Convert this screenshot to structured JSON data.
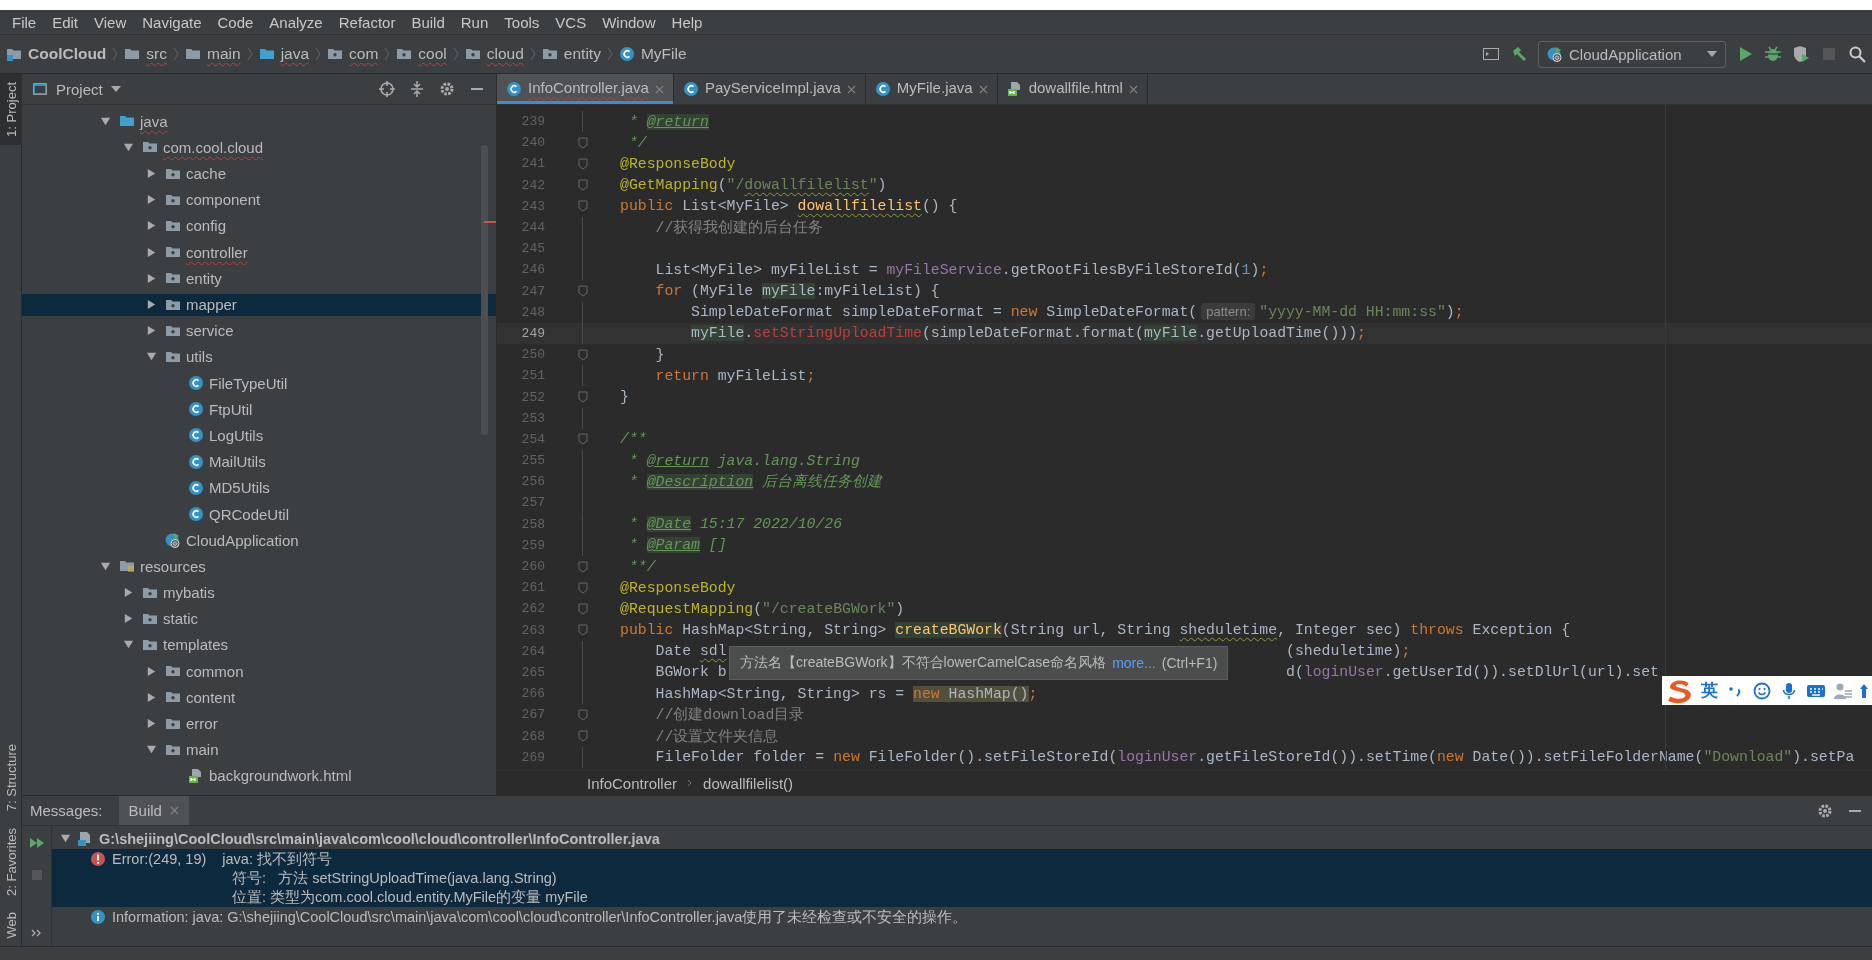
{
  "menu": [
    "File",
    "Edit",
    "View",
    "Navigate",
    "Code",
    "Analyze",
    "Refactor",
    "Build",
    "Run",
    "Tools",
    "VCS",
    "Window",
    "Help"
  ],
  "navigation_bar": [
    {
      "label": "CoolCloud",
      "kind": "project",
      "misspelled": false
    },
    {
      "label": "src",
      "kind": "folder",
      "misspelled": true
    },
    {
      "label": "main",
      "kind": "folder",
      "misspelled": true
    },
    {
      "label": "java",
      "kind": "source-folder",
      "misspelled": true
    },
    {
      "label": "com",
      "kind": "package",
      "misspelled": true
    },
    {
      "label": "cool",
      "kind": "package",
      "misspelled": true
    },
    {
      "label": "cloud",
      "kind": "package",
      "misspelled": true
    },
    {
      "label": "entity",
      "kind": "package",
      "misspelled": false
    },
    {
      "label": "MyFile",
      "kind": "class",
      "misspelled": false
    }
  ],
  "toolbar": {
    "run_configuration": "CloudApplication",
    "stop_enabled": false
  },
  "left_stripe": {
    "top": [
      {
        "label": "1: Project",
        "selected": true
      }
    ],
    "bottom": [
      {
        "label": "7: Structure",
        "selected": false
      },
      {
        "label": "2: Favorites",
        "selected": false
      },
      {
        "label": "Web",
        "selected": false
      }
    ]
  },
  "project_panel": {
    "title": "Project"
  },
  "tree": [
    {
      "label": "java",
      "kind": "source-folder",
      "expanded": true,
      "selected": false,
      "misspelled": true,
      "children": [
        {
          "label": "com.cool.cloud",
          "kind": "package",
          "expanded": true,
          "selected": false,
          "misspelled": true,
          "children": [
            {
              "label": "cache",
              "kind": "package",
              "expanded": false,
              "selected": false,
              "misspelled": false
            },
            {
              "label": "component",
              "kind": "package",
              "expanded": false,
              "selected": false,
              "misspelled": false
            },
            {
              "label": "config",
              "kind": "package",
              "expanded": false,
              "selected": false,
              "misspelled": false
            },
            {
              "label": "controller",
              "kind": "package",
              "expanded": false,
              "selected": false,
              "misspelled": true
            },
            {
              "label": "entity",
              "kind": "package",
              "expanded": false,
              "selected": false,
              "misspelled": false
            },
            {
              "label": "mapper",
              "kind": "package",
              "expanded": false,
              "selected": true,
              "misspelled": false
            },
            {
              "label": "service",
              "kind": "package",
              "expanded": false,
              "selected": false,
              "misspelled": false
            },
            {
              "label": "utils",
              "kind": "package",
              "expanded": true,
              "selected": false,
              "misspelled": false,
              "children": [
                {
                  "label": "FileTypeUtil",
                  "kind": "class",
                  "selected": false,
                  "misspelled": false
                },
                {
                  "label": "FtpUtil",
                  "kind": "class",
                  "selected": false,
                  "misspelled": false
                },
                {
                  "label": "LogUtils",
                  "kind": "class",
                  "selected": false,
                  "misspelled": false
                },
                {
                  "label": "MailUtils",
                  "kind": "class",
                  "selected": false,
                  "misspelled": false
                },
                {
                  "label": "MD5Utils",
                  "kind": "class",
                  "selected": false,
                  "misspelled": false
                },
                {
                  "label": "QRCodeUtil",
                  "kind": "class",
                  "selected": false,
                  "misspelled": false
                }
              ]
            },
            {
              "label": "CloudApplication",
              "kind": "spring-app",
              "selected": false,
              "misspelled": false
            }
          ]
        }
      ]
    },
    {
      "label": "resources",
      "kind": "resources-folder",
      "expanded": true,
      "selected": false,
      "misspelled": false,
      "children": [
        {
          "label": "mybatis",
          "kind": "package",
          "expanded": false,
          "selected": false,
          "misspelled": false
        },
        {
          "label": "static",
          "kind": "package",
          "expanded": false,
          "selected": false,
          "misspelled": false
        },
        {
          "label": "templates",
          "kind": "package",
          "expanded": true,
          "selected": false,
          "misspelled": false,
          "children": [
            {
              "label": "common",
              "kind": "package",
              "expanded": false,
              "selected": false,
              "misspelled": false
            },
            {
              "label": "content",
              "kind": "package",
              "expanded": false,
              "selected": false,
              "misspelled": false
            },
            {
              "label": "error",
              "kind": "package",
              "expanded": false,
              "selected": false,
              "misspelled": false
            },
            {
              "label": "main",
              "kind": "package",
              "expanded": true,
              "selected": false,
              "misspelled": false,
              "children": [
                {
                  "label": "backgroundwork.html",
                  "kind": "html",
                  "selected": false,
                  "misspelled": false
                }
              ]
            }
          ]
        }
      ]
    }
  ],
  "editor_tabs": [
    {
      "label": "InfoController.java",
      "kind": "class",
      "selected": true,
      "misspelled": true
    },
    {
      "label": "PayServiceImpl.java",
      "kind": "class",
      "selected": false,
      "misspelled": false
    },
    {
      "label": "MyFile.java",
      "kind": "class",
      "selected": false,
      "misspelled": false
    },
    {
      "label": "dowallfile.html",
      "kind": "html",
      "selected": false,
      "misspelled": false
    }
  ],
  "code_lines": [
    {
      "number": "239",
      "fold": false,
      "current": false,
      "tokens": [
        {
          "text": " * ",
          "kind": "doc"
        },
        {
          "text": "@return",
          "kind": "doctag",
          "marked": true
        }
      ]
    },
    {
      "number": "240",
      "fold": true,
      "current": false,
      "tokens": [
        {
          "text": " */",
          "kind": "doc"
        }
      ]
    },
    {
      "number": "241",
      "fold": true,
      "current": false,
      "tokens": [
        {
          "text": "@ResponseBody",
          "kind": "annotation"
        }
      ]
    },
    {
      "number": "242",
      "fold": true,
      "current": false,
      "tokens": [
        {
          "text": "@GetMapping",
          "kind": "annotation"
        },
        {
          "text": "(",
          "kind": "plain"
        },
        {
          "text": "\"/",
          "kind": "string"
        },
        {
          "text": "dowallfilelist",
          "kind": "string",
          "squiggle": true
        },
        {
          "text": "\"",
          "kind": "string"
        },
        {
          "text": ")",
          "kind": "plain"
        }
      ]
    },
    {
      "number": "243",
      "fold": true,
      "current": false,
      "tokens": [
        {
          "text": "public ",
          "kind": "keyword"
        },
        {
          "text": "List<MyFile> ",
          "kind": "plain"
        },
        {
          "text": "dowallfilelist",
          "kind": "method",
          "squiggle": true
        },
        {
          "text": "() {",
          "kind": "plain"
        }
      ]
    },
    {
      "number": "244",
      "fold": false,
      "current": false,
      "tokens": [
        {
          "text": "    //获得我创建的后台任务",
          "kind": "comment"
        }
      ]
    },
    {
      "number": "245",
      "fold": false,
      "current": false
    },
    {
      "number": "246",
      "fold": false,
      "current": false,
      "tokens": [
        {
          "text": "    List<MyFile> myFileList = ",
          "kind": "plain"
        },
        {
          "text": "myFileService",
          "kind": "field"
        },
        {
          "text": ".getRootFilesByFileStoreId(",
          "kind": "plain"
        },
        {
          "text": "1",
          "kind": "number"
        },
        {
          "text": ")",
          "kind": "plain"
        },
        {
          "text": ";",
          "kind": "keyword"
        }
      ]
    },
    {
      "number": "247",
      "fold": true,
      "current": false,
      "tokens": [
        {
          "text": "    for ",
          "kind": "keyword"
        },
        {
          "text": "(MyFile ",
          "kind": "plain"
        },
        {
          "text": "myFile",
          "kind": "plain",
          "marked": true
        },
        {
          "text": ":myFileList) {",
          "kind": "plain"
        }
      ]
    },
    {
      "number": "248",
      "fold": false,
      "current": false,
      "tokens": [
        {
          "text": "        SimpleDateFormat simpleDateFormat = ",
          "kind": "plain"
        },
        {
          "text": "new ",
          "kind": "keyword"
        },
        {
          "text": "SimpleDateFormat(",
          "kind": "plain"
        },
        {
          "text": "pattern:",
          "kind": "hint"
        },
        {
          "text": "\"yyyy-MM-dd HH:mm:ss\"",
          "kind": "string"
        },
        {
          "text": ")",
          "kind": "plain"
        },
        {
          "text": ";",
          "kind": "keyword"
        }
      ]
    },
    {
      "number": "249",
      "fold": false,
      "current": true,
      "tokens": [
        {
          "text": "        myFile",
          "kind": "plain",
          "marked": true
        },
        {
          "text": ".",
          "kind": "plain"
        },
        {
          "text": "setStringUploadTime",
          "kind": "error"
        },
        {
          "text": "(simpleDateFormat.format(",
          "kind": "plain"
        },
        {
          "text": "myFile",
          "kind": "plain",
          "marked": true
        },
        {
          "text": ".getUploadTime()))",
          "kind": "plain"
        },
        {
          "text": ";",
          "kind": "keyword"
        }
      ]
    },
    {
      "number": "250",
      "fold": true,
      "current": false,
      "tokens": [
        {
          "text": "    }",
          "kind": "plain"
        }
      ]
    },
    {
      "number": "251",
      "fold": false,
      "current": false,
      "tokens": [
        {
          "text": "    return ",
          "kind": "keyword"
        },
        {
          "text": "myFileList",
          "kind": "plain"
        },
        {
          "text": ";",
          "kind": "keyword"
        }
      ]
    },
    {
      "number": "252",
      "fold": true,
      "current": false,
      "tokens": [
        {
          "text": "}",
          "kind": "plain"
        }
      ]
    },
    {
      "number": "253",
      "fold": false,
      "current": false
    },
    {
      "number": "254",
      "fold": true,
      "current": false,
      "tokens": [
        {
          "text": "/**",
          "kind": "doc"
        }
      ]
    },
    {
      "number": "255",
      "fold": false,
      "current": false,
      "tokens": [
        {
          "text": " * ",
          "kind": "doc"
        },
        {
          "text": "@return",
          "kind": "doctag"
        },
        {
          "text": " java.lang.String",
          "kind": "doc"
        }
      ]
    },
    {
      "number": "256",
      "fold": false,
      "current": false,
      "tokens": [
        {
          "text": " * ",
          "kind": "doc"
        },
        {
          "text": "@Description",
          "kind": "doctag",
          "marked": true
        },
        {
          "text": " 后台离线任务创建",
          "kind": "doc"
        }
      ]
    },
    {
      "number": "257",
      "fold": false,
      "current": false
    },
    {
      "number": "258",
      "fold": false,
      "current": false,
      "tokens": [
        {
          "text": " * ",
          "kind": "doc"
        },
        {
          "text": "@Date",
          "kind": "doctag",
          "marked": true
        },
        {
          "text": " 15:17 2022/10/26",
          "kind": "doc"
        }
      ]
    },
    {
      "number": "259",
      "fold": false,
      "current": false,
      "tokens": [
        {
          "text": " * ",
          "kind": "doc"
        },
        {
          "text": "@Param",
          "kind": "doctag",
          "marked": true
        },
        {
          "text": " []",
          "kind": "doc"
        }
      ]
    },
    {
      "number": "260",
      "fold": true,
      "current": false,
      "tokens": [
        {
          "text": " **/",
          "kind": "doc"
        }
      ]
    },
    {
      "number": "261",
      "fold": true,
      "current": false,
      "tokens": [
        {
          "text": "@ResponseBody",
          "kind": "annotation"
        }
      ]
    },
    {
      "number": "262",
      "fold": true,
      "current": false,
      "tokens": [
        {
          "text": "@RequestMapping",
          "kind": "annotation"
        },
        {
          "text": "(",
          "kind": "plain"
        },
        {
          "text": "\"/createBGWork\"",
          "kind": "string"
        },
        {
          "text": ")",
          "kind": "plain"
        }
      ]
    },
    {
      "number": "263",
      "fold": true,
      "current": false,
      "tokens": [
        {
          "text": "public ",
          "kind": "keyword"
        },
        {
          "text": "HashMap<String, String> ",
          "kind": "plain"
        },
        {
          "text": "createBGWork",
          "kind": "method",
          "marked": true
        },
        {
          "text": "(String url, String ",
          "kind": "plain"
        },
        {
          "text": "sheduletime",
          "kind": "plain",
          "squiggle": true
        },
        {
          "text": ", Integer sec) ",
          "kind": "plain"
        },
        {
          "text": "throws ",
          "kind": "keyword"
        },
        {
          "text": "Exception {",
          "kind": "plain"
        }
      ]
    },
    {
      "number": "264",
      "fold": false,
      "current": false,
      "tokens": [
        {
          "text": "    Date ",
          "kind": "plain"
        },
        {
          "text": "sdl",
          "kind": "plain",
          "squiggle": true
        },
        {
          "text": "                                                               (sheduletime)",
          "kind": "plain"
        },
        {
          "text": ";",
          "kind": "keyword"
        }
      ]
    },
    {
      "number": "265",
      "fold": false,
      "current": false,
      "tokens": [
        {
          "text": "    BGWork b",
          "kind": "plain"
        },
        {
          "text": "                                                               d(",
          "kind": "plain"
        },
        {
          "text": "loginUser",
          "kind": "field"
        },
        {
          "text": ".getUserId()).setDlUrl(url).set",
          "kind": "plain"
        }
      ]
    },
    {
      "number": "266",
      "fold": false,
      "current": false,
      "tokens": [
        {
          "text": "    HashMap<String, String> rs = ",
          "kind": "plain"
        },
        {
          "text": "new ",
          "kind": "keyword",
          "warning": true
        },
        {
          "text": "HashMap()",
          "kind": "plain",
          "warning": true
        },
        {
          "text": ";",
          "kind": "keyword"
        }
      ]
    },
    {
      "number": "267",
      "fold": true,
      "current": false,
      "tokens": [
        {
          "text": "    //创建download目录",
          "kind": "comment"
        }
      ]
    },
    {
      "number": "268",
      "fold": true,
      "current": false,
      "tokens": [
        {
          "text": "    //设置文件夹信息",
          "kind": "comment"
        }
      ]
    },
    {
      "number": "269",
      "fold": false,
      "current": false,
      "tokens": [
        {
          "text": "    FileFolder folder = ",
          "kind": "plain"
        },
        {
          "text": "new ",
          "kind": "keyword"
        },
        {
          "text": "FileFolder().setFileStoreId(",
          "kind": "plain"
        },
        {
          "text": "loginUser",
          "kind": "field"
        },
        {
          "text": ".getFileStoreId()).setTime(",
          "kind": "plain"
        },
        {
          "text": "new ",
          "kind": "keyword"
        },
        {
          "text": "Date()).setFileFolderName(",
          "kind": "plain"
        },
        {
          "text": "\"Download\"",
          "kind": "string"
        },
        {
          "text": ").setPa",
          "kind": "plain"
        }
      ]
    }
  ],
  "tooltip": {
    "message": "方法名【createBGWork】不符合lowerCamelCase命名风格",
    "link": "more...",
    "shortcut": "(Ctrl+F1)"
  },
  "ime_toolbar": {
    "mode": "英"
  },
  "editor_breadcrumb": [
    "InfoController",
    "dowallfilelist()"
  ],
  "messages_panel": {
    "label": "Messages:",
    "tabs": [
      {
        "label": "Build",
        "selected": true
      }
    ],
    "file": {
      "path": "G:\\shejiing\\CoolCloud\\src\\main\\java\\com\\cool\\cloud\\controller\\InfoController.java",
      "expanded": true,
      "messages": [
        {
          "kind": "error",
          "selected": true,
          "location": "Error:(249, 19)",
          "text": "java: 找不到符号",
          "details": [
            "符号:   方法 setStringUploadTime(java.lang.String)",
            "位置: 类型为com.cool.cloud.entity.MyFile的变量 myFile"
          ]
        },
        {
          "kind": "info",
          "selected": false,
          "text": "Information: java: G:\\shejiing\\CoolCloud\\src\\main\\java\\com\\cool\\cloud\\controller\\InfoController.java使用了未经检查或不安全的操作。"
        }
      ]
    }
  }
}
